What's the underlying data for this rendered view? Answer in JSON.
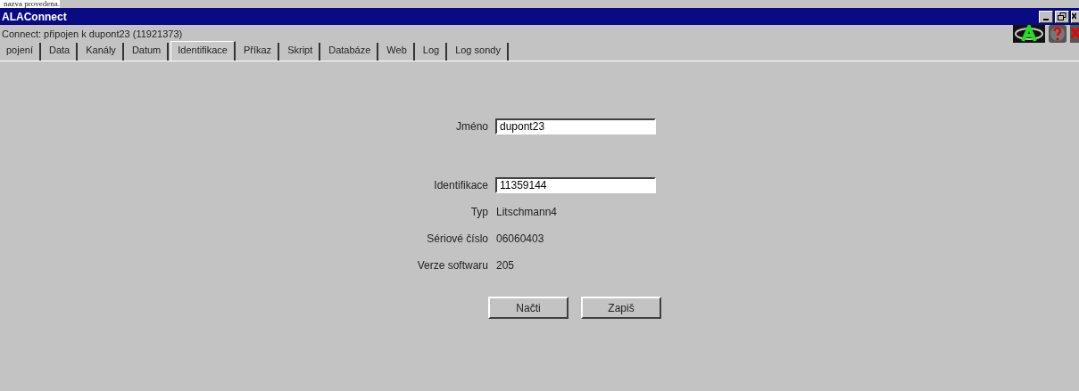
{
  "page_caption": "nazva provedena.",
  "window": {
    "title": "ALAConnect"
  },
  "status": "Connect: připojen k  dupont23 (11921373)",
  "tabs": [
    {
      "label": "pojení",
      "selected": false
    },
    {
      "label": "Data",
      "selected": false
    },
    {
      "label": "Kanály",
      "selected": false
    },
    {
      "label": "Datum",
      "selected": false
    },
    {
      "label": "Identifikace",
      "selected": true
    },
    {
      "label": "Příkaz",
      "selected": false
    },
    {
      "label": "Skript",
      "selected": false
    },
    {
      "label": "Databáze",
      "selected": false
    },
    {
      "label": "Web",
      "selected": false
    },
    {
      "label": "Log",
      "selected": false
    },
    {
      "label": "Log sondy",
      "selected": false
    }
  ],
  "form": [
    {
      "kind": "field",
      "label": "Jméno",
      "value": "dupont23"
    },
    {
      "kind": "spacer"
    },
    {
      "kind": "field",
      "label": "Identifikace",
      "value": "11359144"
    },
    {
      "kind": "text",
      "label": "Typ",
      "value": "Litschmann4"
    },
    {
      "kind": "text",
      "label": "Sériové číslo",
      "value": "06060403"
    },
    {
      "kind": "text",
      "label": "Verze softwaru",
      "value": "205"
    }
  ],
  "buttons": [
    "Načti",
    "Zapiš"
  ]
}
